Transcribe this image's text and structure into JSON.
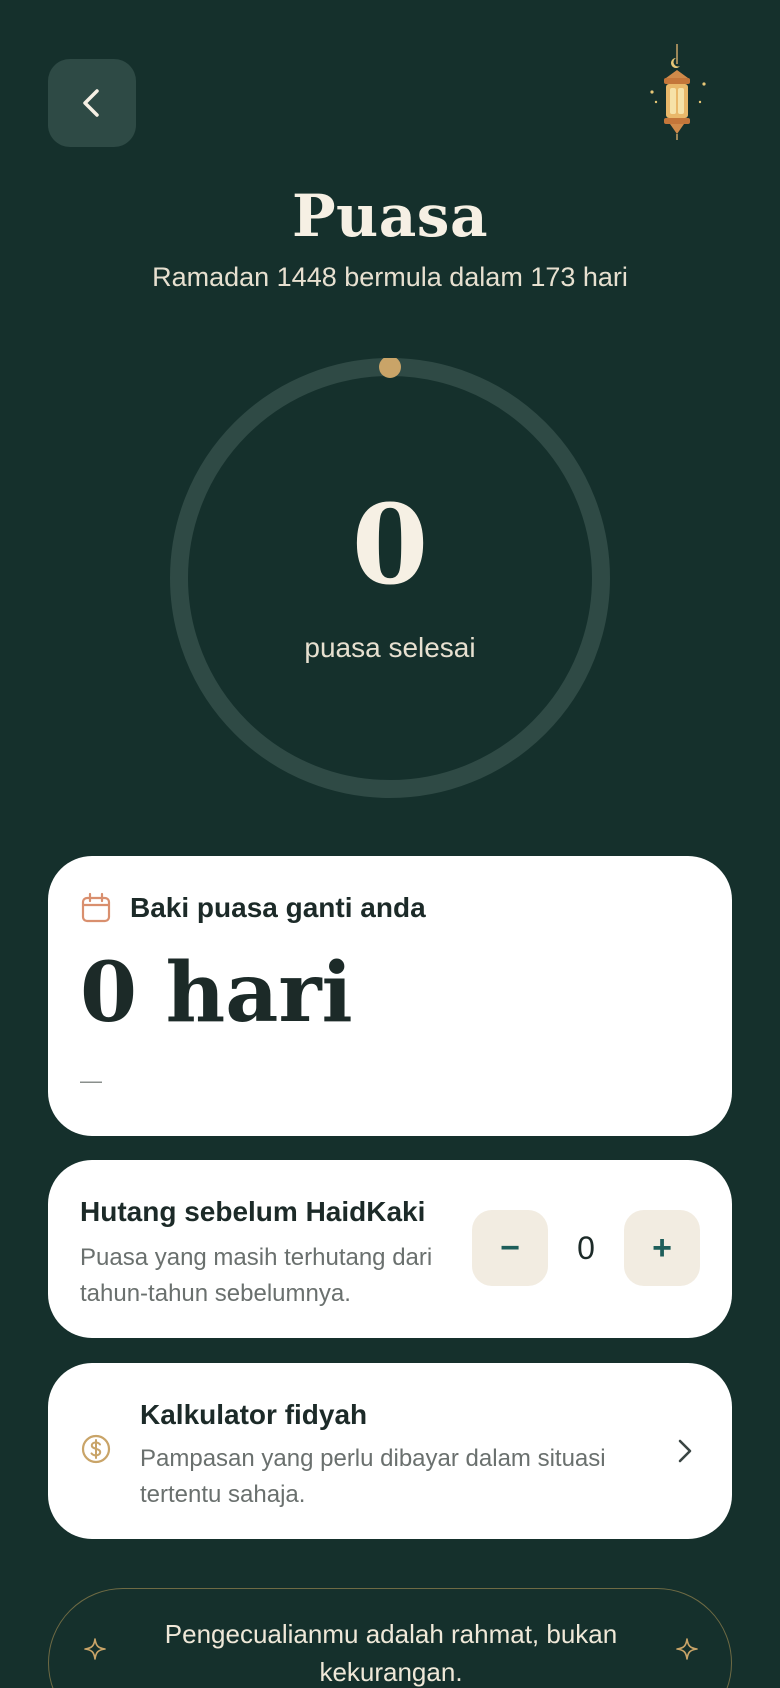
{
  "header": {
    "back_label": "",
    "title": "Puasa",
    "subtitle": "Ramadan 1448 bermula dalam 173 hari"
  },
  "progress": {
    "count": "0",
    "label": "puasa selesai",
    "fraction": 0
  },
  "balance_card": {
    "label": "Baki puasa ganti anda",
    "value": "0 hari",
    "note": "—"
  },
  "debt_card": {
    "title": "Hutang sebelum HaidKaki",
    "description": "Puasa yang masih terhutang dari tahun-tahun sebelumnya.",
    "minus_label": "−",
    "value": "0",
    "plus_label": "+"
  },
  "fidyah_card": {
    "title": "Kalkulator fidyah",
    "description": "Pampasan yang perlu dibayar dalam situasi tertentu sahaja."
  },
  "quote": {
    "text": "Pengecualianmu adalah rahmat, bukan kekurangan."
  },
  "colors": {
    "background": "#15302C",
    "accent_gold": "#C9A468",
    "card": "#FFFFFF",
    "stepper_bg": "#F2ECE1",
    "stepper_fg": "#1E5E5A",
    "calendar_icon": "#D98F6E"
  },
  "icons": {
    "back": "chevron-left-icon",
    "lantern": "lantern-icon",
    "calendar": "calendar-icon",
    "coin": "coin-icon",
    "chevron": "chevron-right-icon",
    "sparkle": "sparkle-icon"
  }
}
